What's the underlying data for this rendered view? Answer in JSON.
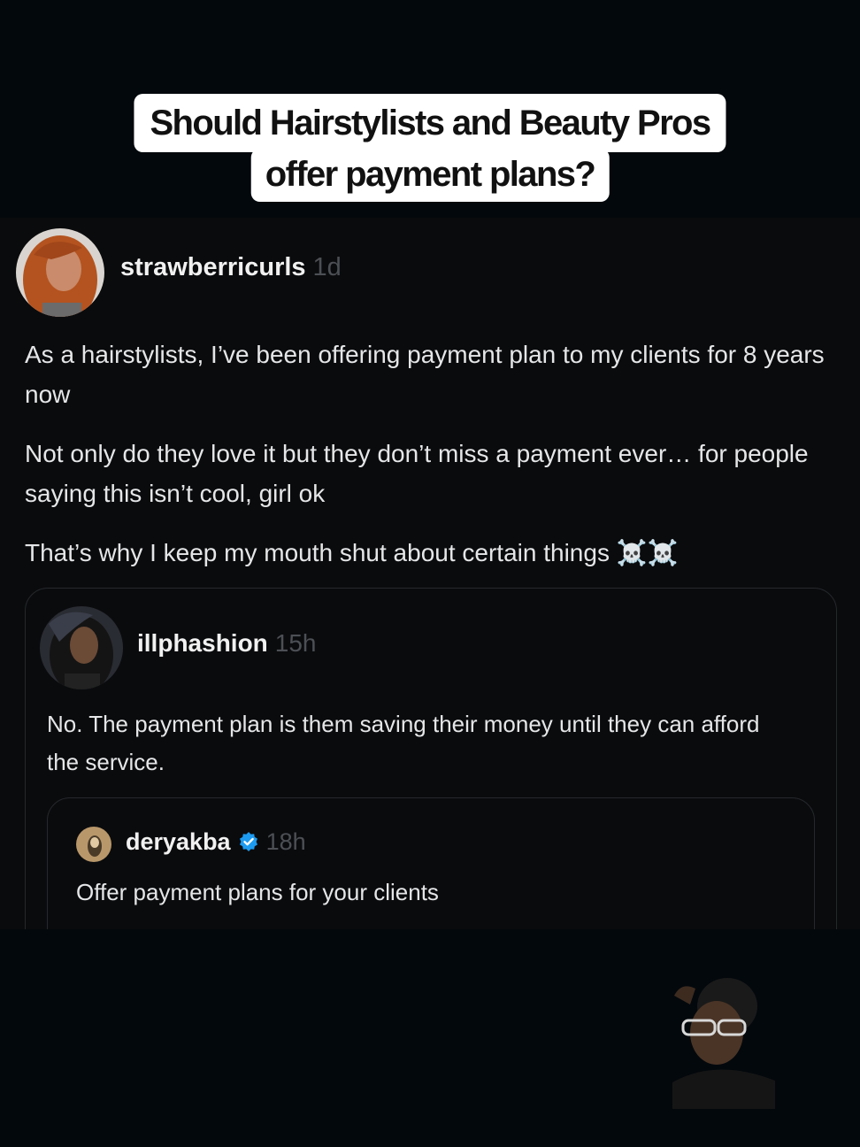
{
  "caption": {
    "line1": "Should Hairstylists and Beauty Pros",
    "line2": "offer payment plans?"
  },
  "post": {
    "username": "strawberricurls",
    "time": "1d",
    "paragraphs": [
      "As a hairstylists, I’ve been offering payment plan to my clients for 8 years now",
      "Not only do they love it but they don’t miss a payment ever… for people saying this isn’t cool, girl ok",
      "That’s why I keep my mouth shut about certain things ☠️☠️"
    ]
  },
  "quoted_post": {
    "username": "illphashion",
    "time": "15h",
    "text": "No. The payment plan is them saving their money until they can afford the service."
  },
  "nested_quote": {
    "username": "deryakba",
    "verified_icon": "verified-badge-icon",
    "time": "18h",
    "text": "Offer payment plans for your clients"
  },
  "colors": {
    "background": "#03080c",
    "thread_bg": "#0a0b0d",
    "timestamp": "#4c4f54",
    "verified": "#1d9bf0"
  }
}
